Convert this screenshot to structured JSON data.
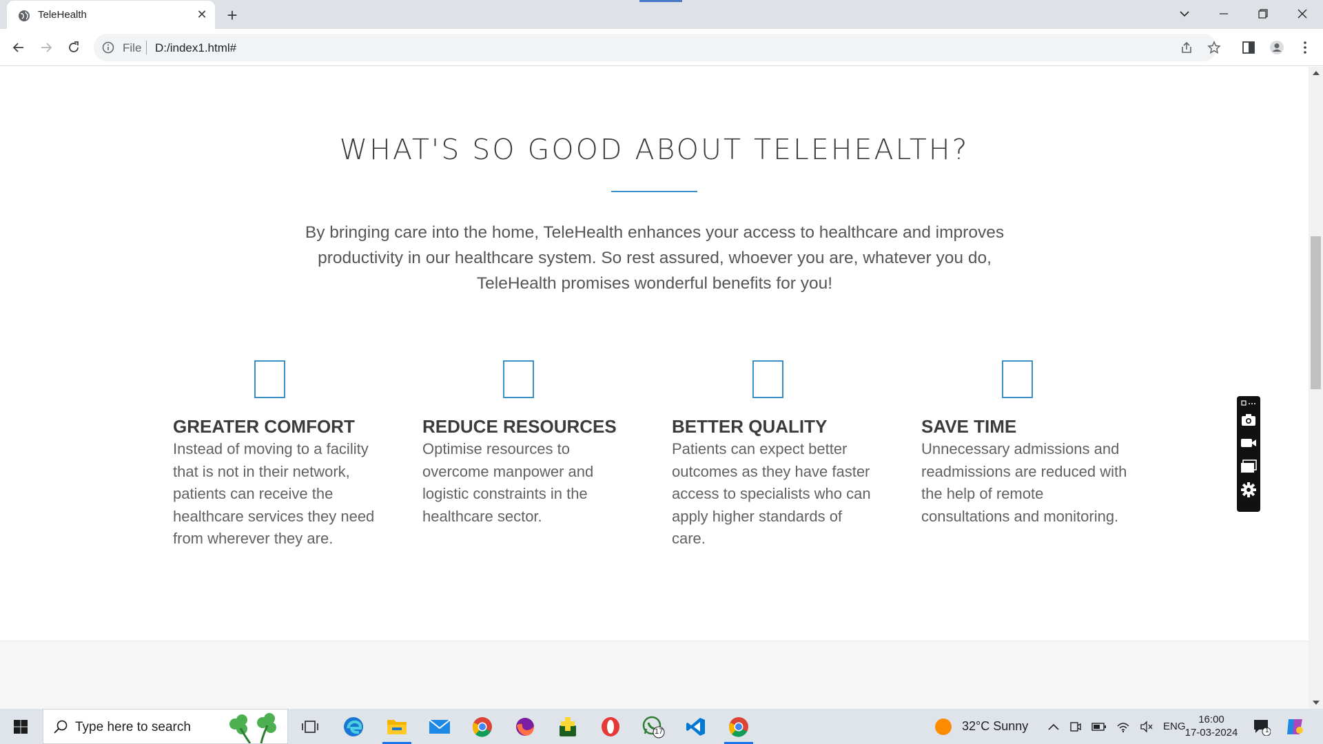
{
  "browser": {
    "tab_title": "TeleHealth",
    "tab_close": "✕",
    "new_tab": "+",
    "omnibox_scheme": "File",
    "omnibox_url": "D:/index1.html#"
  },
  "page": {
    "heading": "WHAT'S SO GOOD ABOUT TELEHEALTH?",
    "intro": "By bringing care into the home, TeleHealth enhances your access to healthcare and improves productivity in our healthcare system. So rest assured, whoever you are, whatever you do, TeleHealth promises wonderful benefits for you!",
    "features": [
      {
        "title": "GREATER COMFORT",
        "text": "Instead of moving to a facility that is not in their network, patients can receive the healthcare services they need from wherever they are."
      },
      {
        "title": "REDUCE RESOURCES",
        "text": "Optimise resources to overcome manpower and logistic constraints in the healthcare sector."
      },
      {
        "title": "BETTER QUALITY",
        "text": "Patients can expect better outcomes as they have faster access to specialists who can apply higher standards of care."
      },
      {
        "title": "SAVE TIME",
        "text": "Unnecessary admissions and readmissions are reduced with the help of remote consultations and monitoring."
      }
    ],
    "accent_color": "#3a8fc7"
  },
  "taskbar": {
    "search_placeholder": "Type here to search",
    "whatsapp_badge": "17",
    "weather": "32°C  Sunny",
    "language": "ENG",
    "time": "16:00",
    "date": "17-03-2024",
    "notification_count": "1"
  }
}
